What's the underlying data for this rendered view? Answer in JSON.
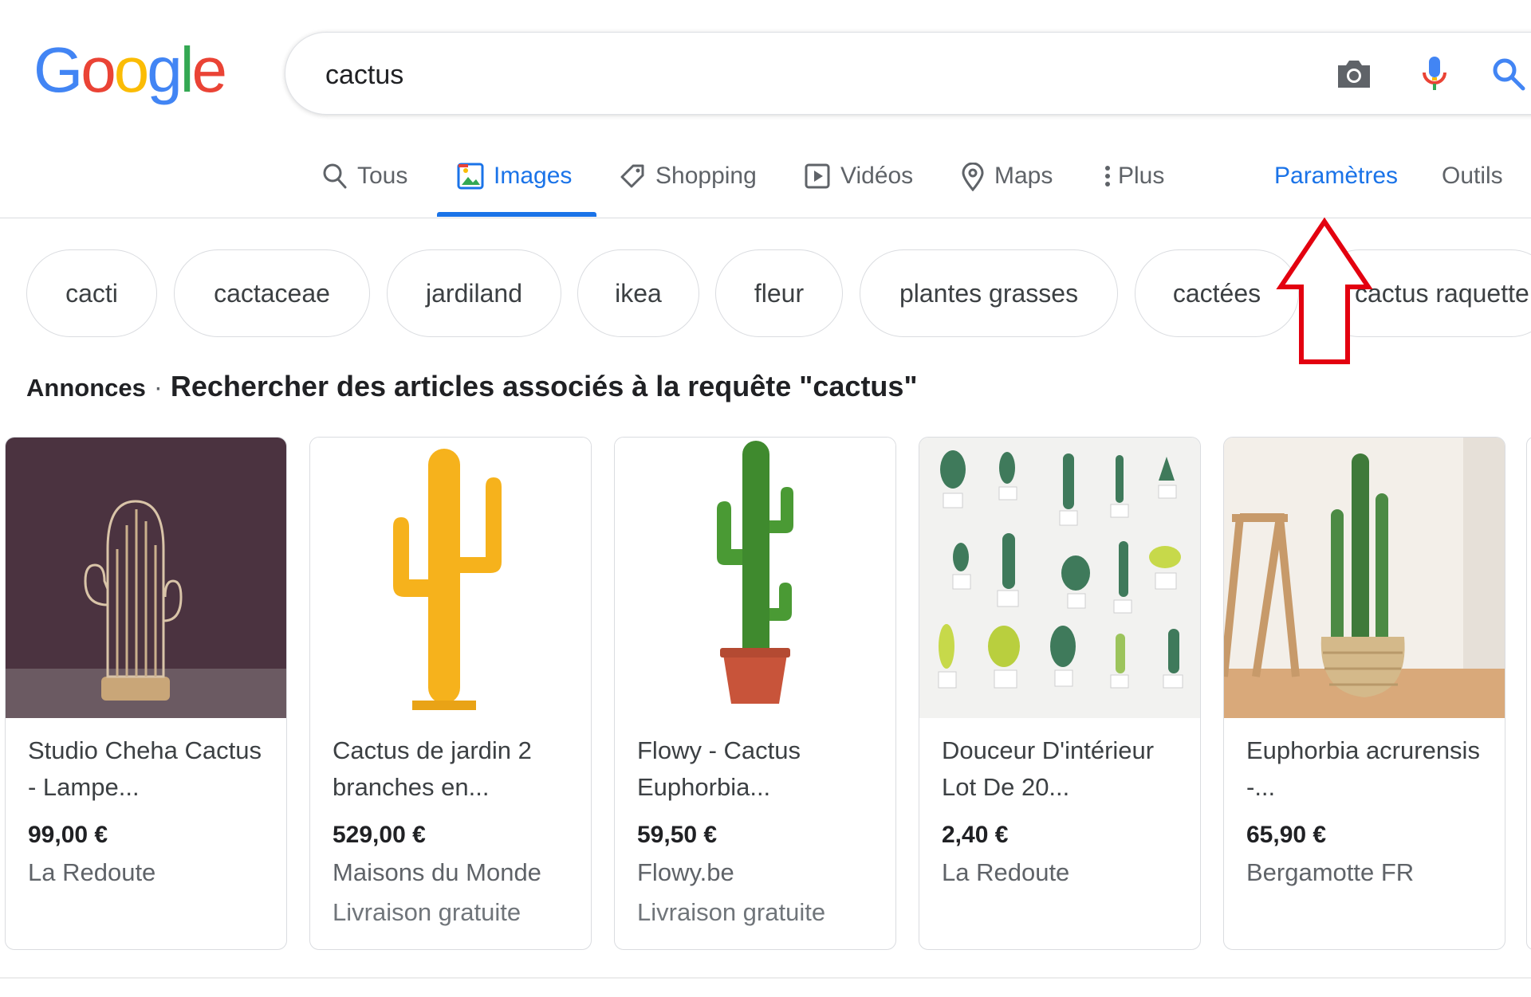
{
  "logo": {
    "letters": [
      "G",
      "o",
      "o",
      "g",
      "l",
      "e"
    ],
    "colors": [
      "#4285f4",
      "#ea4335",
      "#fbbc05",
      "#4285f4",
      "#34a853",
      "#ea4335"
    ]
  },
  "search": {
    "value": "cactus"
  },
  "tabs": [
    {
      "label": "Tous",
      "icon": "search-icon"
    },
    {
      "label": "Images",
      "icon": "image-icon",
      "active": true
    },
    {
      "label": "Shopping",
      "icon": "tag-icon"
    },
    {
      "label": "Vidéos",
      "icon": "play-icon"
    },
    {
      "label": "Maps",
      "icon": "map-pin-icon"
    },
    {
      "label": "Plus",
      "icon": "more-vert-icon"
    }
  ],
  "tools": {
    "settings": "Paramètres",
    "tools": "Outils"
  },
  "chips": [
    "cacti",
    "cactaceae",
    "jardiland",
    "ikea",
    "fleur",
    "plantes grasses",
    "cactées",
    "cactus raquette"
  ],
  "ads": {
    "label": "Annonces",
    "separator": "·",
    "title": "Rechercher des articles associés à la requête \"cactus\""
  },
  "products": [
    {
      "name": "Studio Cheha Cactus - Lampe...",
      "price": "99,00 €",
      "store": "La Redoute",
      "shipping": ""
    },
    {
      "name": "Cactus de jardin 2 branches en...",
      "price": "529,00 €",
      "store": "Maisons du Monde",
      "shipping": "Livraison gratuite"
    },
    {
      "name": "Flowy - Cactus Euphorbia...",
      "price": "59,50 €",
      "store": "Flowy.be",
      "shipping": "Livraison gratuite"
    },
    {
      "name": "Douceur D'intérieur Lot De 20...",
      "price": "2,40 €",
      "store": "La Redoute",
      "shipping": ""
    },
    {
      "name": "Euphorbia acrurensis -...",
      "price": "65,90 €",
      "store": "Bergamotte FR",
      "shipping": ""
    }
  ],
  "colors": {
    "accent": "#1a73e8",
    "annotation_arrow": "#e3000f"
  }
}
